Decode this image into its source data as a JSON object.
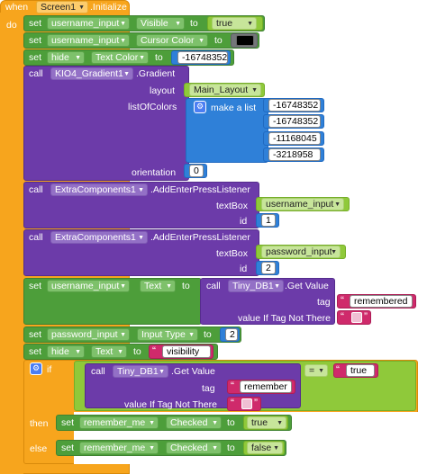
{
  "event": {
    "when_label": "when",
    "component": "Screen1",
    "event_name": ".Initialize",
    "do_label": "do"
  },
  "keywords": {
    "set": "set",
    "to": "to",
    "call": "call",
    "if": "if",
    "then": "then",
    "else": "else"
  },
  "row1": {
    "component": "username_input",
    "property": "Visible",
    "value": "true"
  },
  "row2": {
    "component": "username_input",
    "property": "Cursor Color",
    "color": "#000000"
  },
  "row3": {
    "component": "hide",
    "property": "Text Color",
    "value": "-16748352"
  },
  "gradient_call": {
    "component": "KIO4_Gradient1",
    "method": ".Gradient",
    "layout_label": "layout",
    "layout_value": "Main_Layout",
    "list_label": "listOfColors",
    "make_list": "make a list",
    "colors": [
      "-16748352",
      "-16748352",
      "-11168045",
      "-3218958"
    ],
    "orientation_label": "orientation",
    "orientation_value": "0"
  },
  "enter1": {
    "component": "ExtraComponents1",
    "method": ".AddEnterPressListener",
    "textbox_label": "textBox",
    "textbox_value": "username_input",
    "id_label": "id",
    "id_value": "1"
  },
  "enter2": {
    "component": "ExtraComponents1",
    "method": ".AddEnterPressListener",
    "textbox_label": "textBox",
    "textbox_value": "password_input",
    "id_label": "id",
    "id_value": "2"
  },
  "set_text": {
    "component": "username_input",
    "property": "Text",
    "db": "Tiny_DB1",
    "method": ".Get Value",
    "tag_label": "tag",
    "tag_value": "remembered",
    "notthere_label": "value If Tag Not There"
  },
  "set_inputtype": {
    "component": "password_input",
    "property": "Input Type",
    "value": "2"
  },
  "set_hidetext": {
    "component": "hide",
    "property": "Text",
    "value": "visibility"
  },
  "if_block": {
    "db": "Tiny_DB1",
    "method": ".Get Value",
    "tag_label": "tag",
    "tag_value": "remember",
    "notthere_label": "value If Tag Not There",
    "op": "=",
    "compare_value": "true"
  },
  "then_set": {
    "component": "remember_me",
    "property": "Checked",
    "value": "true"
  },
  "else_set": {
    "component": "remember_me",
    "property": "Checked",
    "value": "false"
  },
  "colors": {
    "event": "#f7a51d",
    "setter": "#4d9e3a",
    "call": "#6c3ba9",
    "list": "#2f80d8",
    "logic": "#8fc93a",
    "text": "#cf2a6b",
    "math": "#2f80d8"
  }
}
